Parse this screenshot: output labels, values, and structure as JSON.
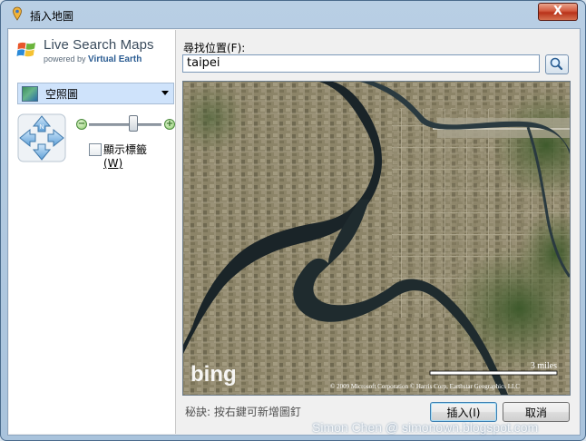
{
  "window": {
    "title": "插入地圖",
    "close_label": "X"
  },
  "brand": {
    "name": "Live Search Maps",
    "powered_prefix": "powered by",
    "powered_by": "Virtual Earth"
  },
  "map_style": {
    "selected": "空照圖"
  },
  "controls": {
    "zoom_minus": "−",
    "zoom_plus": "+",
    "pan_north": "N",
    "show_labels": "顯示標籤",
    "show_labels_accel": "(W)"
  },
  "search": {
    "label": "尋找位置(F):",
    "value": "taipei"
  },
  "map": {
    "bing_logo": "bing",
    "scale_label": "3 miles",
    "copyright": "© 2009 Microsoft Corporation  © Harris Corp, Earthstar Geographics LLC"
  },
  "tip": "秘訣: 按右鍵可新增圖釘",
  "buttons": {
    "insert": "插入(I)",
    "cancel": "取消"
  },
  "watermark": "Simon Chen @ simonown.blogspot.com"
}
